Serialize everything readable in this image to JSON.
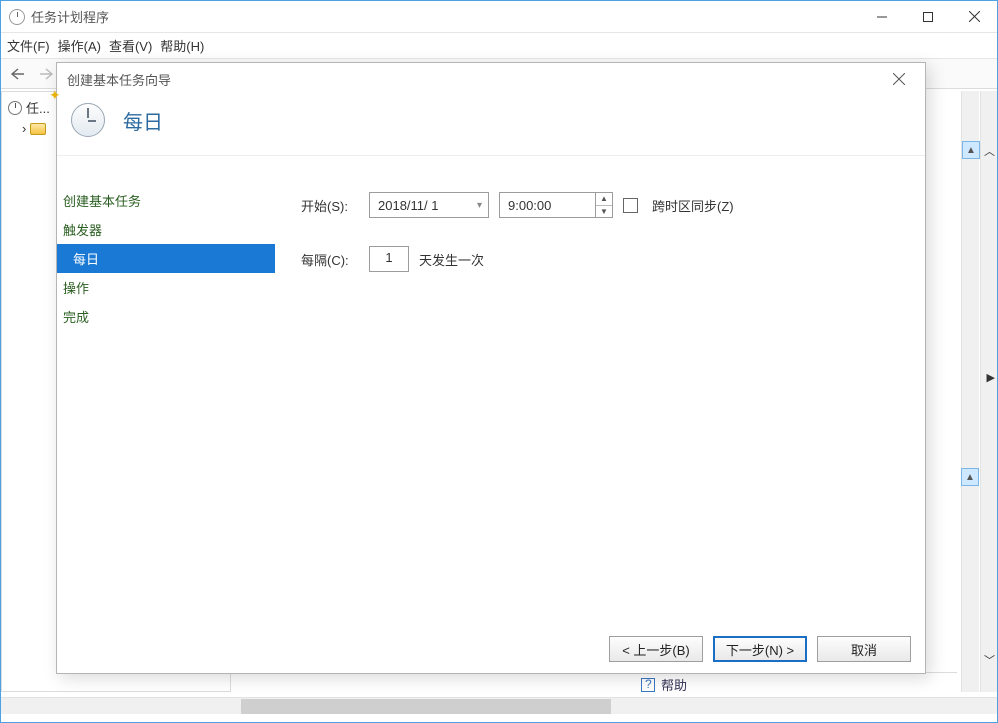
{
  "outer": {
    "title": "任务计划程序",
    "menu": {
      "file": "文件(F)",
      "action": "操作(A)",
      "view": "查看(V)",
      "help": "帮助(H)"
    },
    "tree": {
      "root": "任...",
      "child_expander": "›"
    },
    "bottom_help": "帮助"
  },
  "dialog": {
    "title": "创建基本任务向导",
    "heading": "每日",
    "nav": {
      "create": "创建基本任务",
      "trigger": "触发器",
      "daily": "每日",
      "action": "操作",
      "finish": "完成"
    },
    "form": {
      "start_label": "开始(S):",
      "date_value": "2018/11/ 1",
      "time_value": "9:00:00",
      "sync_tz_label": "跨时区同步(Z)",
      "interval_label": "每隔(C):",
      "interval_value": "1",
      "interval_suffix": "天发生一次"
    },
    "buttons": {
      "back": "< 上一步(B)",
      "next": "下一步(N) >",
      "cancel": "取消"
    }
  }
}
